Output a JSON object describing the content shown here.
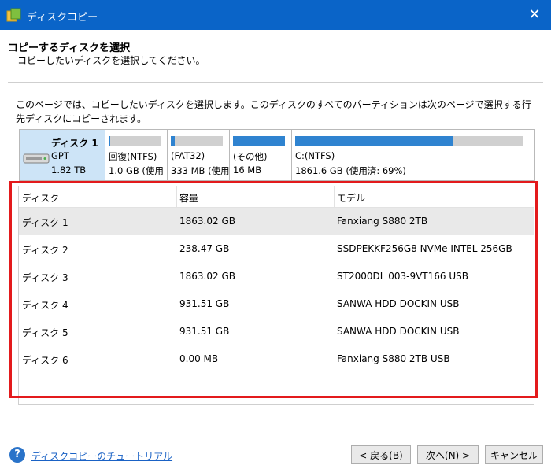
{
  "window": {
    "title": "ディスクコピー",
    "close_glyph": "✕"
  },
  "header": {
    "title": "コピーするディスクを選択",
    "subtitle": "コピーしたいディスクを選択してください。"
  },
  "description": "このページでは、コピーしたいディスクを選択します。このディスクのすべてのパーティションは次のページで選択する行先ディスクにコピーされます。",
  "disk_map": {
    "disk": {
      "name": "ディスク 1",
      "type": "GPT",
      "size": "1.82 TB"
    },
    "partitions": [
      {
        "label": "回復(NTFS)",
        "info": "1.0 GB (使用",
        "used_fraction": 0.03
      },
      {
        "label": "(FAT32)",
        "info": "333 MB (使用",
        "used_fraction": 0.08
      },
      {
        "label": "(その他)",
        "info": "16 MB",
        "used_fraction": 1.0
      },
      {
        "label": "C:(NTFS)",
        "info": "1861.6 GB (使用済: 69%)",
        "used_fraction": 0.69
      }
    ]
  },
  "table": {
    "headers": [
      "ディスク",
      "容量",
      "モデル"
    ],
    "rows": [
      {
        "disk": "ディスク 1",
        "capacity": "1863.02 GB",
        "model": "Fanxiang S880 2TB"
      },
      {
        "disk": "ディスク 2",
        "capacity": "238.47 GB",
        "model": "SSDPEKKF256G8 NVMe INTEL 256GB"
      },
      {
        "disk": "ディスク 3",
        "capacity": "1863.02 GB",
        "model": "ST2000DL 003-9VT166 USB"
      },
      {
        "disk": "ディスク 4",
        "capacity": "931.51 GB",
        "model": "SANWA HDD DOCKIN USB"
      },
      {
        "disk": "ディスク 5",
        "capacity": "931.51 GB",
        "model": "SANWA HDD DOCKIN USB"
      },
      {
        "disk": "ディスク 6",
        "capacity": "0.00 MB",
        "model": "Fanxiang S880 2TB USB"
      }
    ],
    "selected_row": 0
  },
  "footer": {
    "help_icon": "?",
    "help_link": "ディスクコピーのチュートリアル",
    "back": "< 戻る(B)",
    "next": "次へ(N) >",
    "cancel": "キャンセル"
  },
  "colors": {
    "titlebar": "#0a64c8",
    "highlight_border": "#e31a1c",
    "partition_fill": "#2f83d0",
    "selected_disk_bg": "#cde4f7"
  },
  "icons": {
    "app": "disk-copy-app-icon",
    "disk": "hard-disk-icon",
    "help": "help-icon",
    "close": "close-icon"
  }
}
